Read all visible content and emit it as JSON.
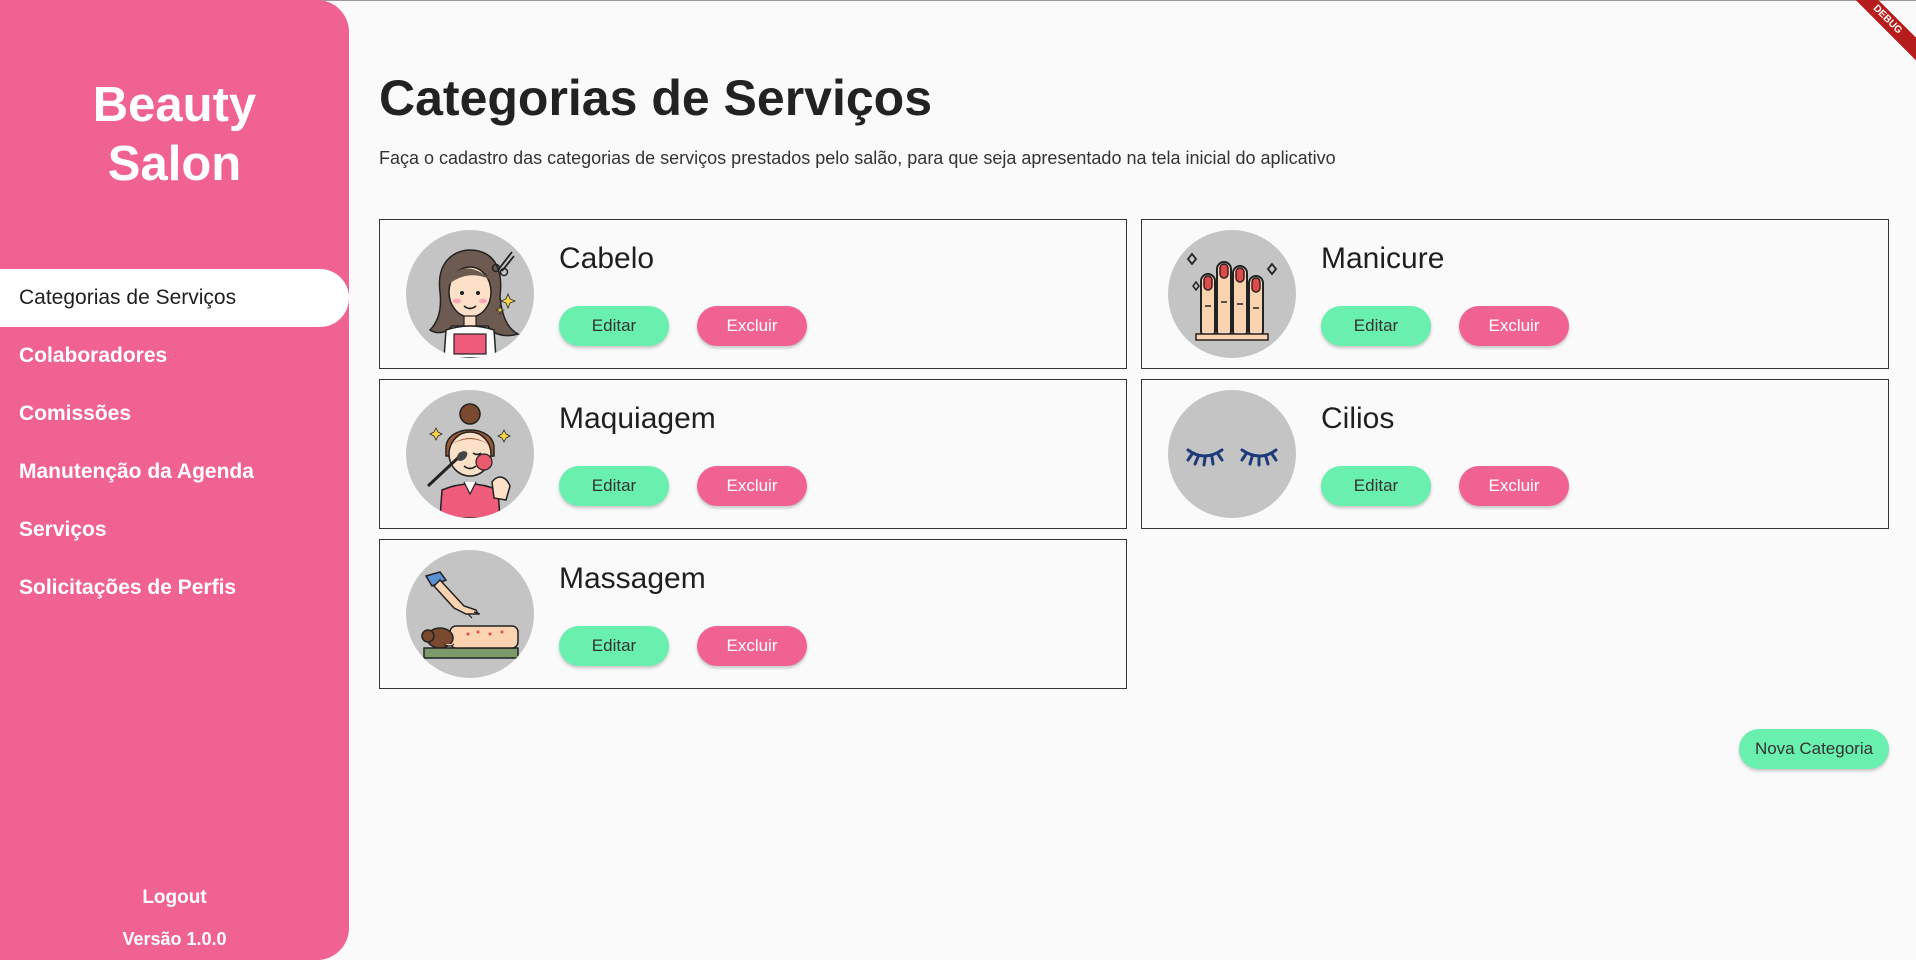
{
  "app": {
    "brand_line1": "Beauty",
    "brand_line2": "Salon",
    "debug_banner": "DEBUG"
  },
  "sidebar": {
    "items": [
      {
        "label": "Categorias de Serviços",
        "active": true
      },
      {
        "label": "Colaboradores",
        "active": false
      },
      {
        "label": "Comissões",
        "active": false
      },
      {
        "label": "Manutenção da Agenda",
        "active": false
      },
      {
        "label": "Serviços",
        "active": false
      },
      {
        "label": "Solicitações de Perfis",
        "active": false
      }
    ],
    "logout_label": "Logout",
    "version_label": "Versão 1.0.0"
  },
  "main": {
    "title": "Categorias de Serviços",
    "subtitle": "Faça o cadastro das categorias de serviços prestados pelo salão, para que seja apresentado na tela inicial do aplicativo",
    "new_button_label": "Nova Categoria",
    "categories": [
      {
        "name": "Cabelo",
        "icon": "hair-woman-icon",
        "edit_label": "Editar",
        "delete_label": "Excluir"
      },
      {
        "name": "Manicure",
        "icon": "manicure-hand-icon",
        "edit_label": "Editar",
        "delete_label": "Excluir"
      },
      {
        "name": "Maquiagem",
        "icon": "makeup-woman-icon",
        "edit_label": "Editar",
        "delete_label": "Excluir"
      },
      {
        "name": "Cilios",
        "icon": "eyelashes-icon",
        "edit_label": "Editar",
        "delete_label": "Excluir"
      },
      {
        "name": "Massagem",
        "icon": "massage-icon",
        "edit_label": "Editar",
        "delete_label": "Excluir"
      }
    ]
  },
  "colors": {
    "sidebar": "#f06292",
    "edit_button": "#69f0ae",
    "delete_button": "#f06292",
    "avatar_bg": "#c4c4c4"
  }
}
